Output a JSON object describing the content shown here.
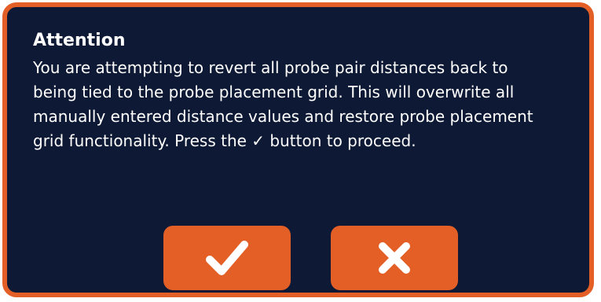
{
  "dialog": {
    "title": "Attention",
    "message": "You are attempting to revert all probe pair distances back to\nbeing tied to the probe placement grid.  This will overwrite all\nmanually entered distance values and restore probe placement\ngrid functionality.  Press the ✓ button to proceed.",
    "buttons": {
      "confirm_icon": "checkmark-icon",
      "cancel_icon": "close-icon"
    }
  },
  "colors": {
    "background": "#0e1a35",
    "accent": "#e35f25",
    "text": "#ffffff"
  }
}
